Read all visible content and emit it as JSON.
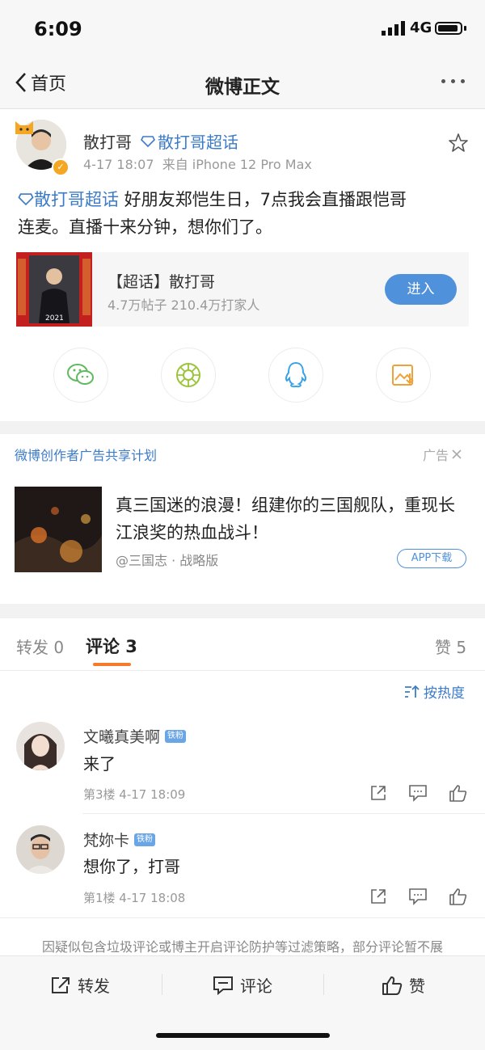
{
  "status": {
    "time": "6:09",
    "network": "4G"
  },
  "nav": {
    "back_label": "首页",
    "title": "微博正文"
  },
  "post": {
    "username": "散打哥",
    "topic_name": "散打哥超话",
    "time": "4-17 18:07",
    "source": "来自 iPhone 12 Pro Max",
    "topic_link": "散打哥超话",
    "text_line1": " 好朋友郑恺生日，7点我会直播跟恺哥",
    "text_line2": "连麦。直播十来分钟，想你们了。",
    "supertopic": {
      "title": "【超话】散打哥",
      "stats": "4.7万帖子 210.4万打家人",
      "button": "进入",
      "image_text": "2021"
    }
  },
  "share_icons": [
    "wechat-icon",
    "moments-icon",
    "qq-icon",
    "save-image-icon"
  ],
  "ad": {
    "program": "微博创作者广告共享计划",
    "tag": "广告",
    "text": "真三国迷的浪漫！组建你的三国舰队，重现长江浪奖的热血战斗！",
    "source": "@三国志 · 战略版",
    "button": "APP下载"
  },
  "tabs": {
    "repost": "转发 0",
    "comment": "评论 3",
    "like": "赞 5"
  },
  "sort_label": "按热度",
  "comments": [
    {
      "name": "文曦真美啊",
      "badge": "铁粉",
      "text": "来了",
      "meta": "第3楼 4-17 18:09"
    },
    {
      "name": "梵妳卡",
      "badge": "铁粉",
      "text": "想你了，打哥",
      "meta": "第1楼 4-17 18:08"
    }
  ],
  "notice": "因疑似包含垃圾评论或博主开启评论防护等过滤策略，部分评论暂不展",
  "bottom": {
    "repost": "转发",
    "comment": "评论",
    "like": "赞"
  },
  "colors": {
    "link": "#3b7bc8",
    "accent": "#f57b2c",
    "button": "#4f91da"
  }
}
